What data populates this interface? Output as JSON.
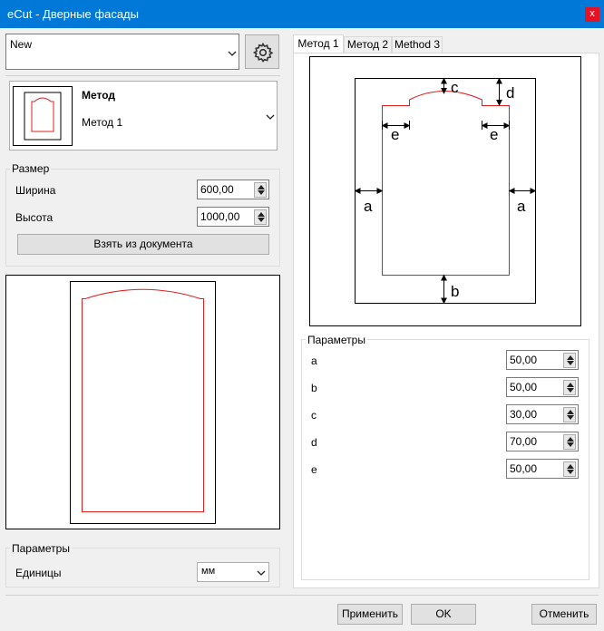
{
  "window": {
    "title": "eCut - Дверные фасады",
    "close_label": "x"
  },
  "template": {
    "value": "New"
  },
  "method": {
    "heading": "Метод",
    "value": "Метод 1"
  },
  "size": {
    "group_label": "Размер",
    "width_label": "Ширина",
    "width_value": "600,00",
    "height_label": "Высота",
    "height_value": "1000,00",
    "take_button": "Взять из документа"
  },
  "params": {
    "group_label": "Параметры",
    "units_label": "Единицы",
    "units_value": "мм"
  },
  "tabs": [
    {
      "label": "Метод 1",
      "active": true
    },
    {
      "label": "Метод 2",
      "active": false
    },
    {
      "label": "Method 3",
      "active": false
    }
  ],
  "diagram": {
    "labels": {
      "a": "a",
      "b": "b",
      "c": "c",
      "d": "d",
      "e": "e"
    }
  },
  "right_params": {
    "group_label": "Параметры",
    "items": [
      {
        "label": "a",
        "value": "50,00"
      },
      {
        "label": "b",
        "value": "50,00"
      },
      {
        "label": "c",
        "value": "30,00"
      },
      {
        "label": "d",
        "value": "70,00"
      },
      {
        "label": "e",
        "value": "50,00"
      }
    ]
  },
  "footer": {
    "apply": "Применить",
    "ok": "OK",
    "cancel": "Отменить"
  },
  "colors": {
    "accent": "#0078d7",
    "contour": "#e02020",
    "close": "#e81123"
  }
}
